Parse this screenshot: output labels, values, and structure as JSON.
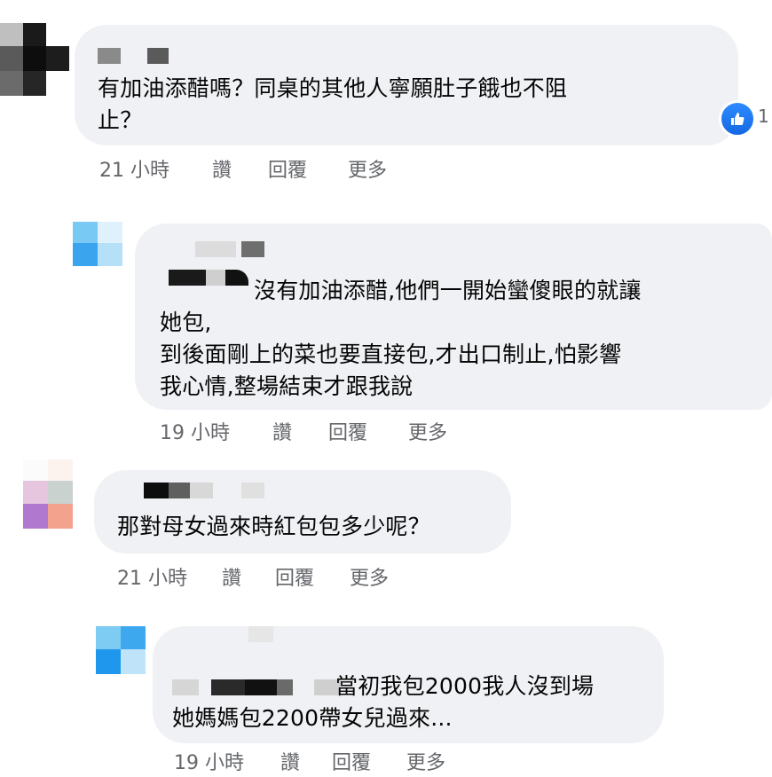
{
  "comments": [
    {
      "text": "有加油添醋嗎？同桌的其他人寧願肚子餓也不阻\n止？",
      "time": "21 小時",
      "like_label": "讚",
      "reply_label": "回覆",
      "more_label": "更多",
      "reaction_count": "1",
      "reaction_icon": "thumbs-up-icon"
    },
    {
      "text": "沒有加油添醋,他們一開始蠻傻眼的就讓\n她包,\n到後面剛上的菜也要直接包,才出口制止,怕影響\n我心情,整場結束才跟我說",
      "time": "19 小時",
      "like_label": "讚",
      "reply_label": "回覆",
      "more_label": "更多"
    },
    {
      "text": "那對母女過來時紅包包多少呢？",
      "time": "21 小時",
      "like_label": "讚",
      "reply_label": "回覆",
      "more_label": "更多"
    },
    {
      "text": "當初我包2000我人沒到場\n她媽媽包2200帶女兒過來...",
      "time": "19 小時",
      "like_label": "讚",
      "reply_label": "回覆",
      "more_label": "更多"
    }
  ],
  "colors": {
    "bubble": "#eff1f4",
    "meta_text": "#65676b",
    "like_blue": "#1877f2"
  }
}
